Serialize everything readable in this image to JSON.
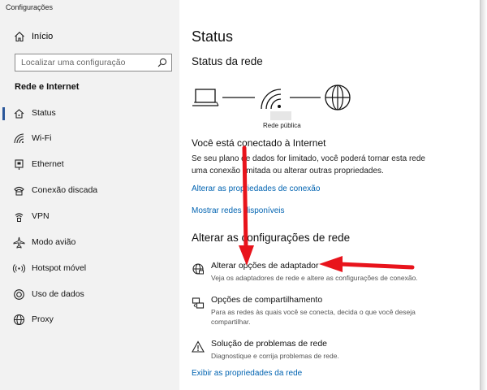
{
  "app": {
    "title": "Configurações"
  },
  "sidebar": {
    "home_label": "Início",
    "search_placeholder": "Localizar uma configuração",
    "section_title": "Rede e Internet",
    "items": [
      {
        "label": "Status",
        "icon": "home-network-icon",
        "active": true
      },
      {
        "label": "Wi-Fi",
        "icon": "wifi-icon",
        "active": false
      },
      {
        "label": "Ethernet",
        "icon": "ethernet-icon",
        "active": false
      },
      {
        "label": "Conexão discada",
        "icon": "dialup-icon",
        "active": false
      },
      {
        "label": "VPN",
        "icon": "vpn-icon",
        "active": false
      },
      {
        "label": "Modo avião",
        "icon": "airplane-icon",
        "active": false
      },
      {
        "label": "Hotspot móvel",
        "icon": "hotspot-icon",
        "active": false
      },
      {
        "label": "Uso de dados",
        "icon": "data-usage-icon",
        "active": false
      },
      {
        "label": "Proxy",
        "icon": "globe-icon",
        "active": false
      }
    ]
  },
  "main": {
    "title": "Status",
    "network_status_title": "Status da rede",
    "network_name": "Rede pública",
    "connected_title": "Você está conectado à Internet",
    "connected_desc": "Se seu plano de dados for limitado, você poderá tornar esta rede uma conexão limitada ou alterar outras propriedades.",
    "link_change_props": "Alterar as propriedades de conexão",
    "link_show_networks": "Mostrar redes disponíveis",
    "change_settings_title": "Alterar as configurações de rede",
    "options": [
      {
        "title": "Alterar opções de adaptador",
        "desc": "Veja os adaptadores de rede e altere as configurações de conexão.",
        "icon": "adapter-icon"
      },
      {
        "title": "Opções de compartilhamento",
        "desc": "Para as redes às quais você se conecta, decida o que você deseja compartilhar.",
        "icon": "sharing-icon"
      },
      {
        "title": "Solução de problemas de rede",
        "desc": "Diagnostique e corrija problemas de rede.",
        "icon": "warning-icon"
      }
    ],
    "link_view_props": "Exibir as propriedades da rede"
  },
  "annotation": {
    "arrow_color": "#e8141c"
  },
  "colors": {
    "accent": "#2b579a",
    "link": "#0063b1",
    "sidebar_bg": "#f2f2f2"
  }
}
